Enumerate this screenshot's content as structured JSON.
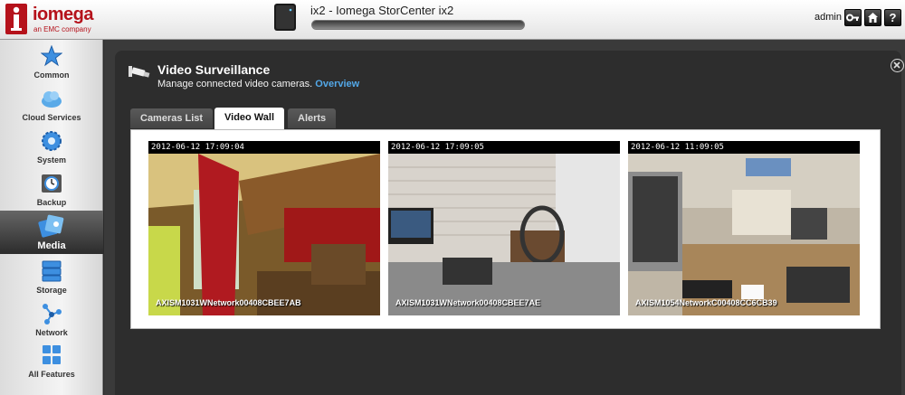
{
  "header": {
    "brand": "iomega",
    "brand_sub": "an EMC company",
    "device_title": "ix2 - Iomega StorCenter ix2",
    "capacity_fraction": 1.0,
    "user": "admin"
  },
  "sidebar": {
    "items": [
      {
        "label": "Common",
        "icon": "star-icon"
      },
      {
        "label": "Cloud Services",
        "icon": "cloud-icon"
      },
      {
        "label": "System",
        "icon": "gear-icon"
      },
      {
        "label": "Backup",
        "icon": "backup-clock-icon"
      },
      {
        "label": "Media",
        "icon": "media-icon",
        "active": true
      },
      {
        "label": "Storage",
        "icon": "storage-icon"
      },
      {
        "label": "Network",
        "icon": "network-icon"
      },
      {
        "label": "All Features",
        "icon": "grid-icon"
      }
    ]
  },
  "panel": {
    "title": "Video Surveillance",
    "subtitle": "Manage connected video cameras.",
    "overview_link": "Overview",
    "tabs": [
      {
        "label": "Cameras List",
        "active": false
      },
      {
        "label": "Video Wall",
        "active": true
      },
      {
        "label": "Alerts",
        "active": false
      }
    ],
    "cameras": [
      {
        "timestamp": "2012-06-12 17:09:04",
        "name": "AXISM1031WNetwork00408CBEE7AB"
      },
      {
        "timestamp": "2012-06-12 17:09:05",
        "name": "AXISM1031WNetwork00408CBEE7AE"
      },
      {
        "timestamp": "2012-06-12 11:09:05",
        "name": "AXISM1054NetworkC00408CC6CB39"
      }
    ]
  },
  "colors": {
    "brand_red": "#b5121b",
    "link_blue": "#53a8e8",
    "panel_bg": "#2d2d2d"
  }
}
